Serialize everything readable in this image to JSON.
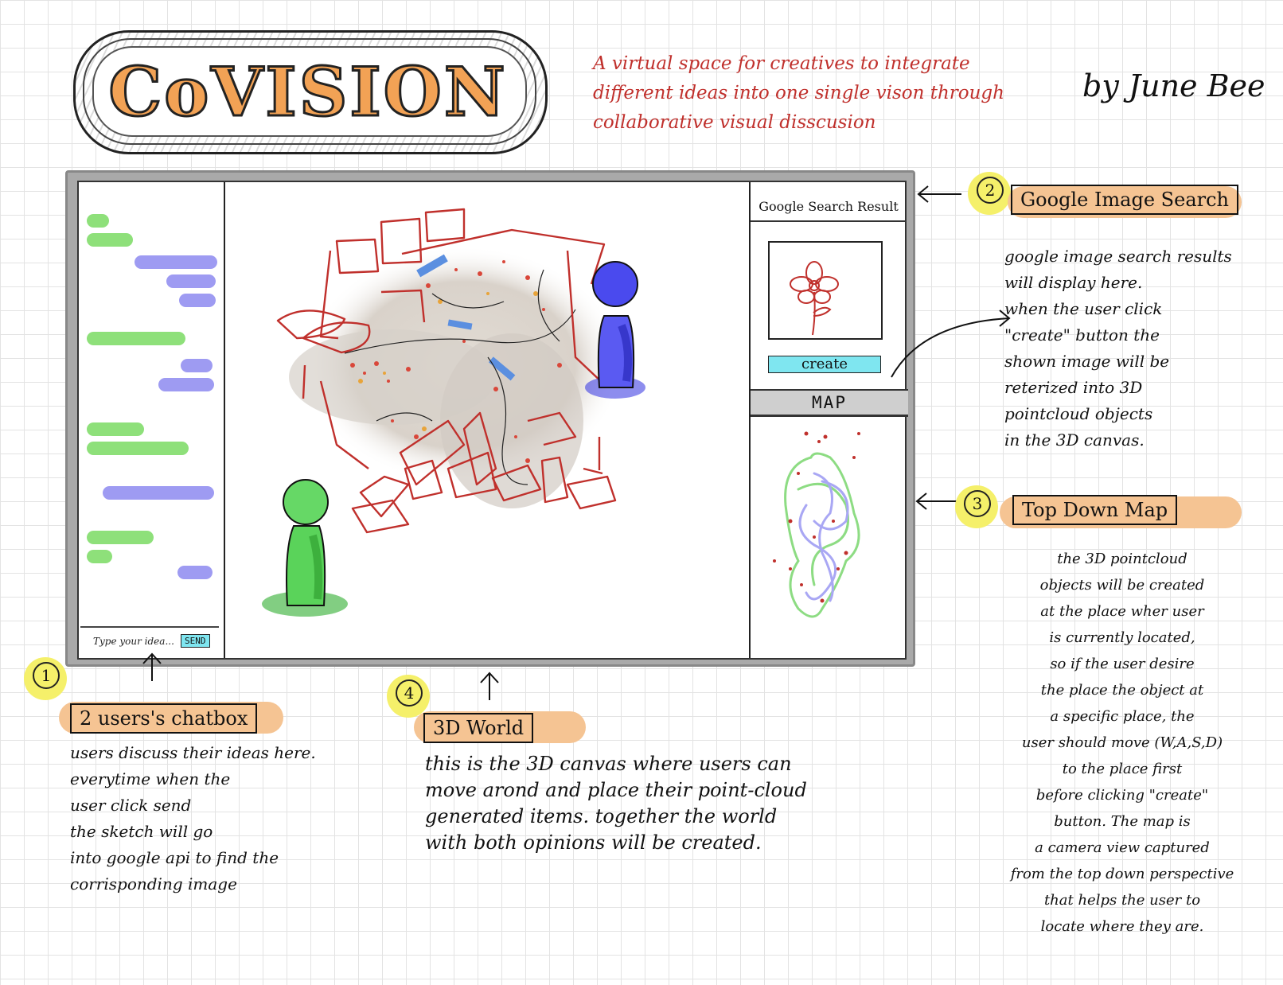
{
  "header": {
    "logo_text": "CoVISION",
    "tagline": "A virtual space for creatives to integrate different ideas into one single vison through collaborative visual disscusion",
    "byline": "by June Bee"
  },
  "app": {
    "chat": {
      "input_placeholder": "Type your idea...",
      "send_label": "SEND"
    },
    "side_panel": {
      "search_result_label": "Google Search Result",
      "create_label": "create",
      "map_label": "MAP"
    }
  },
  "callouts": [
    {
      "number": "1",
      "title": "2 users's chatbox",
      "text": "users discuss their ideas here.\neverytime when the\nuser click send\nthe sketch will go\ninto google api to find the\ncorrisponding image"
    },
    {
      "number": "2",
      "title": "Google Image Search",
      "text": "google image search results\nwill display here.\nwhen the user click\n\"create\" button the\nshown image will be\nreterized into 3D\npointcloud objects\nin the 3D canvas."
    },
    {
      "number": "3",
      "title": "Top Down Map",
      "text": "the 3D pointcloud\nobjects will be created\nat the place wher user\nis currently located,\nso if the user desire\nthe place the object at\na specific place, the\nuser should move (W,A,S,D)\nto the place first\nbefore clicking \"create\"\nbutton. The map is\na camera view captured\nfrom the top down perspective\nthat helps the user to\nlocate where they are."
    },
    {
      "number": "4",
      "title": "3D World",
      "text": "this is the 3D canvas where users can\nmove arond and place their point-cloud\ngenerated items. together the world\nwith both opinions will be created."
    }
  ],
  "colors": {
    "user_green": "#8ee07a",
    "user_blue": "#9e9bf2",
    "button_cyan": "#7fe6f0",
    "tag_orange": "#f5c493",
    "callout_yellow": "#f5f06a",
    "sketch_red": "#c0302c",
    "logo_orange": "#f2a255"
  }
}
